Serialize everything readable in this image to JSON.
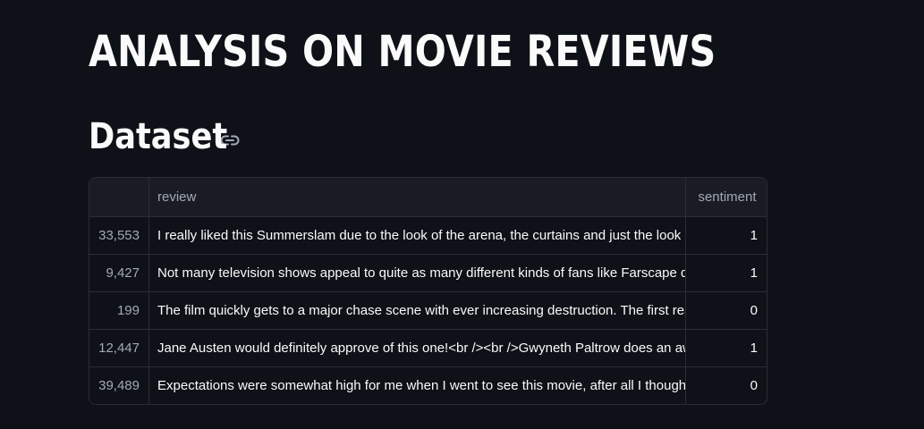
{
  "page": {
    "title": "ANALYSIS ON MOVIE REVIEWS",
    "section_heading": "Dataset",
    "section_link_icon": "link-icon"
  },
  "table": {
    "columns": {
      "index": "",
      "review": "review",
      "sentiment": "sentiment"
    },
    "rows": [
      {
        "index": "33,553",
        "review": "I really liked this Summerslam due to the look of the arena, the curtains and just the look overall",
        "sentiment": "1"
      },
      {
        "index": "9,427",
        "review": "Not many television shows appeal to quite as many different kinds of fans like Farscape does",
        "sentiment": "1"
      },
      {
        "index": "199",
        "review": "The film quickly gets to a major chase scene with ever increasing destruction. The first really bad thing",
        "sentiment": "0"
      },
      {
        "index": "12,447",
        "review": "Jane Austen would definitely approve of this one!<br /><br />Gwyneth Paltrow does an awesome job",
        "sentiment": "1"
      },
      {
        "index": "39,489",
        "review": "Expectations were somewhat high for me when I went to see this movie, after all I thought Steve Carell",
        "sentiment": "0"
      }
    ]
  }
}
